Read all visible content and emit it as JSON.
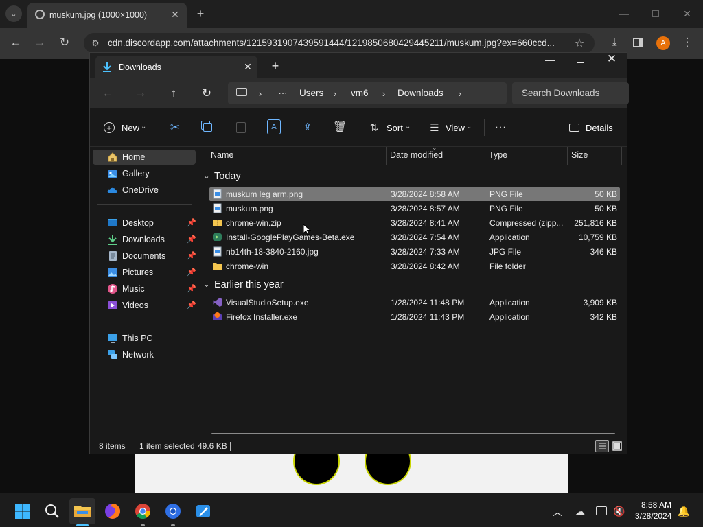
{
  "browser": {
    "tab_title": "muskum.jpg (1000×1000)",
    "url": "cdn.discordapp.com/attachments/1215931907439591444/1219850680429445211/muskum.jpg?ex=660ccd...",
    "profile_initial": "A"
  },
  "explorer": {
    "tab_title": "Downloads",
    "breadcrumb": [
      "Users",
      "vm6",
      "Downloads"
    ],
    "search_placeholder": "Search Downloads",
    "commands": {
      "new": "New",
      "sort": "Sort",
      "view": "View",
      "details": "Details"
    },
    "columns": {
      "name": "Name",
      "date": "Date modified",
      "type": "Type",
      "size": "Size"
    },
    "sidebar": {
      "top": [
        {
          "label": "Home",
          "icon": "home-icon"
        },
        {
          "label": "Gallery",
          "icon": "gallery-icon"
        },
        {
          "label": "OneDrive",
          "icon": "onedrive-icon"
        }
      ],
      "pinned": [
        {
          "label": "Desktop",
          "icon": "desktop-icon"
        },
        {
          "label": "Downloads",
          "icon": "downloads-icon"
        },
        {
          "label": "Documents",
          "icon": "documents-icon"
        },
        {
          "label": "Pictures",
          "icon": "pictures-icon"
        },
        {
          "label": "Music",
          "icon": "music-icon"
        },
        {
          "label": "Videos",
          "icon": "videos-icon"
        }
      ],
      "bottom": [
        {
          "label": "This PC",
          "icon": "this-pc-icon"
        },
        {
          "label": "Network",
          "icon": "network-icon"
        }
      ]
    },
    "groups": [
      {
        "title": "Today",
        "files": [
          {
            "name": "muskum leg arm.png",
            "date": "3/28/2024 8:58 AM",
            "type": "PNG File",
            "size": "50 KB",
            "icon": "png-file-icon"
          },
          {
            "name": "muskum.png",
            "date": "3/28/2024 8:57 AM",
            "type": "PNG File",
            "size": "50 KB",
            "icon": "png-file-icon"
          },
          {
            "name": "chrome-win.zip",
            "date": "3/28/2024 8:41 AM",
            "type": "Compressed (zipp...",
            "size": "251,816 KB",
            "icon": "zip-folder-icon"
          },
          {
            "name": "Install-GooglePlayGames-Beta.exe",
            "date": "3/28/2024 7:54 AM",
            "type": "Application",
            "size": "10,759 KB",
            "icon": "google-play-games-icon"
          },
          {
            "name": "nb14th-18-3840-2160.jpg",
            "date": "3/28/2024 7:33 AM",
            "type": "JPG File",
            "size": "346 KB",
            "icon": "jpg-file-icon"
          },
          {
            "name": "chrome-win",
            "date": "3/28/2024 8:42 AM",
            "type": "File folder",
            "size": "",
            "icon": "folder-icon"
          }
        ]
      },
      {
        "title": "Earlier this year",
        "files": [
          {
            "name": "VisualStudioSetup.exe",
            "date": "1/28/2024 11:48 PM",
            "type": "Application",
            "size": "3,909 KB",
            "icon": "visual-studio-icon"
          },
          {
            "name": "Firefox Installer.exe",
            "date": "1/28/2024 11:43 PM",
            "type": "Application",
            "size": "342 KB",
            "icon": "firefox-installer-icon"
          }
        ]
      }
    ],
    "status": {
      "items": "8 items",
      "selected": "1 item selected",
      "size": "49.6 KB"
    }
  },
  "taskbar": {
    "time": "8:58 AM",
    "date": "3/28/2024"
  },
  "colors": {
    "accent": "#4cc2ff",
    "selection": "#777777",
    "profile": "#e8710a",
    "folder": "#f4c64f"
  }
}
